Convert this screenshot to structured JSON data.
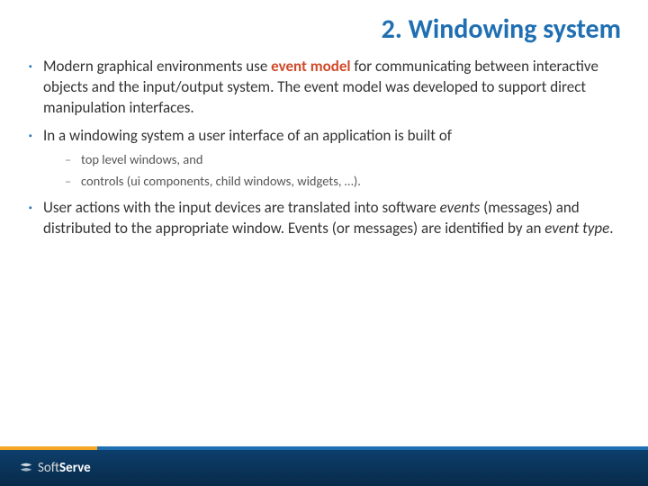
{
  "title": "2. Windowing system",
  "bullets": {
    "b1_pre": "Modern graphical environments use ",
    "b1_hl": "event model",
    "b1_post": " for communicating between interactive objects and the input/output system. The event model was developed to support direct manipulation interfaces.",
    "b2": "In a windowing system a user interface of an application is built of",
    "b2_sub1": "top level windows, and",
    "b2_sub2": "controls (ui components, child windows, widgets, …).",
    "b3_pre": "User actions with the input devices are translated into software ",
    "b3_it1": "events",
    "b3_mid": " (messages) and distributed to the appropriate window. Events (or messages) are identified by an ",
    "b3_it2": "event type",
    "b3_post": "."
  },
  "footer": {
    "brand_soft": "Soft",
    "brand_serve": "Serve"
  }
}
